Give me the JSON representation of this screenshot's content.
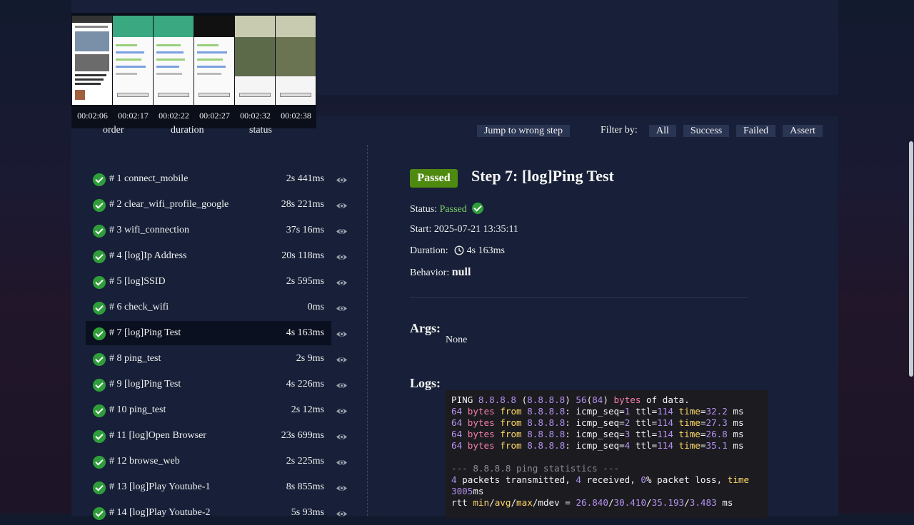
{
  "timeline": {
    "timestamps": [
      "00:02:06",
      "00:02:17",
      "00:02:22",
      "00:02:27",
      "00:02:32",
      "00:02:38"
    ]
  },
  "table_header": {
    "order": "order",
    "duration": "duration",
    "status": "status"
  },
  "toolbar": {
    "jump_label": "Jump to wrong step",
    "filter_label": "Filter by:",
    "filters": [
      "All",
      "Success",
      "Failed",
      "Assert"
    ]
  },
  "steps": [
    {
      "label": "# 1  connect_mobile",
      "duration": "2s 441ms"
    },
    {
      "label": "# 2  clear_wifi_profile_google",
      "duration": "28s 221ms"
    },
    {
      "label": "# 3  wifi_connection",
      "duration": "37s 16ms"
    },
    {
      "label": "# 4  [log]Ip Address",
      "duration": "20s 118ms"
    },
    {
      "label": "# 5  [log]SSID",
      "duration": "2s 595ms"
    },
    {
      "label": "# 6  check_wifi",
      "duration": "0ms"
    },
    {
      "label": "# 7  [log]Ping Test",
      "duration": "4s 163ms"
    },
    {
      "label": "# 8  ping_test",
      "duration": "2s 9ms"
    },
    {
      "label": "# 9  [log]Ping Test",
      "duration": "4s 226ms"
    },
    {
      "label": "# 10  ping_test",
      "duration": "2s 12ms"
    },
    {
      "label": "# 11  [log]Open Browser",
      "duration": "23s 699ms"
    },
    {
      "label": "# 12  browse_web",
      "duration": "2s 225ms"
    },
    {
      "label": "# 13  [log]Play Youtube-1",
      "duration": "8s 855ms"
    },
    {
      "label": "# 14  [log]Play Youtube-2",
      "duration": "5s 93ms"
    }
  ],
  "detail": {
    "badge": "Passed",
    "title": "Step 7: [log]Ping Test",
    "status_label": "Status:",
    "status_value": "Passed",
    "start_label": "Start:",
    "start_value": "2025-07-21 13:35:11",
    "duration_label": "Duration:",
    "duration_value": "4s 163ms",
    "behavior_label": "Behavior:",
    "behavior_value": "null",
    "args_title": "Args:",
    "args_value": "None",
    "logs_title": "Logs:",
    "log_lines": [
      "PING 8.8.8.8 (8.8.8.8) 56(84) bytes of data.",
      "64 bytes from 8.8.8.8: icmp_seq=1 ttl=114 time=32.2 ms",
      "64 bytes from 8.8.8.8: icmp_seq=2 ttl=114 time=27.3 ms",
      "64 bytes from 8.8.8.8: icmp_seq=3 ttl=114 time=26.8 ms",
      "64 bytes from 8.8.8.8: icmp_seq=4 ttl=114 time=35.1 ms",
      "",
      "--- 8.8.8.8 ping statistics ---",
      "4 packets transmitted, 4 received, 0% packet loss, time 3005ms",
      "rtt min/avg/max/mdev = 26.840/30.410/35.193/3.483 ms"
    ]
  },
  "colors": {
    "passed": "#4f8a10",
    "success_check": "#2f9e3a",
    "panel": "#172038",
    "pill": "#2a3553"
  }
}
